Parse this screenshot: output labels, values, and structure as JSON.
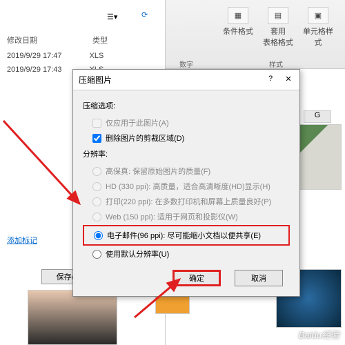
{
  "ribbon": {
    "items": [
      {
        "label": "条件格式"
      },
      {
        "label": "套用\n表格格式"
      },
      {
        "label": "单元格样式"
      }
    ],
    "group_numbers": "数字",
    "group_styles": "样式"
  },
  "file_browser": {
    "col_date": "修改日期",
    "col_type": "类型",
    "rows": [
      {
        "date": "2019/9/29 17:47",
        "type": "XLS"
      },
      {
        "date": "2019/9/29 17:43",
        "type": "XLS"
      }
    ],
    "add_tag": "添加标记",
    "save": "保存(S)"
  },
  "grid": {
    "col_g": "G"
  },
  "dialog": {
    "title": "压缩图片",
    "help": "?",
    "close": "✕",
    "compress_section": "压缩选项:",
    "only_this": "仅应用于此图片(A)",
    "delete_crop": "删除图片的剪裁区域(D)",
    "resolution_section": "分辨率:",
    "options": {
      "fidelity": "高保真: 保留原始图片的质量(F)",
      "hd": "HD (330 ppi): 高质量，适合高清晰度(HD)显示(H)",
      "print": "打印(220 ppi): 在多数打印机和屏幕上质量良好(P)",
      "web": "Web (150 ppi): 适用于网页和投影仪(W)",
      "email": "电子邮件(96 ppi): 尽可能缩小文档以便共享(E)",
      "default": "使用默认分辨率(U)"
    },
    "ok": "确定",
    "cancel": "取消"
  },
  "watermark": "Baidu经验"
}
